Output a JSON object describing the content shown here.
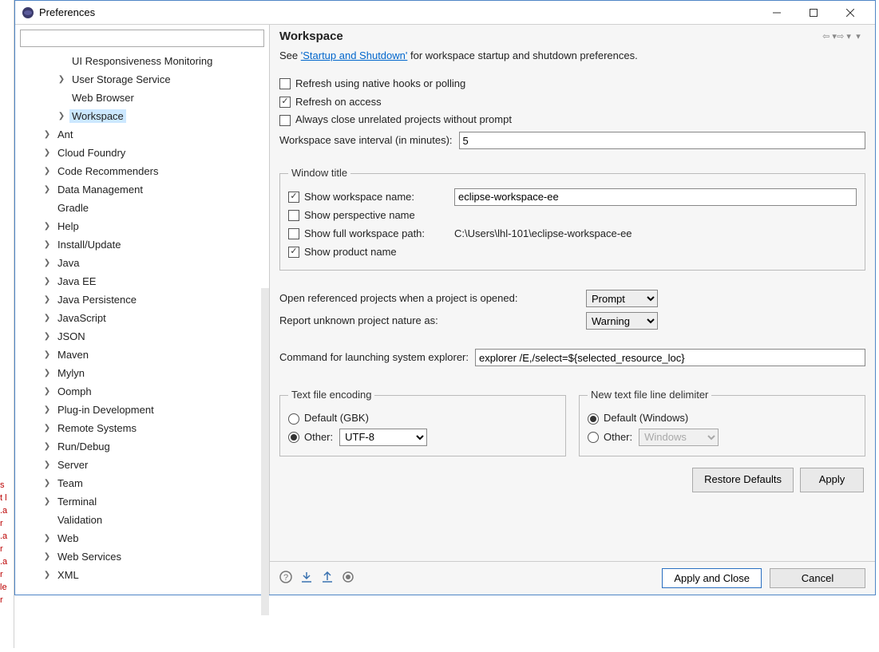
{
  "window": {
    "title": "Preferences"
  },
  "header": {
    "title": "Workspace",
    "see_prefix": "See ",
    "see_link": "'Startup and Shutdown'",
    "see_suffix": " for workspace startup and shutdown preferences."
  },
  "tree": [
    {
      "label": "UI Responsiveness Monitoring",
      "indent": 2,
      "expandable": false
    },
    {
      "label": "User Storage Service",
      "indent": 2,
      "expandable": true
    },
    {
      "label": "Web Browser",
      "indent": 2,
      "expandable": false
    },
    {
      "label": "Workspace",
      "indent": 2,
      "expandable": true,
      "selected": true
    },
    {
      "label": "Ant",
      "indent": 1,
      "expandable": true
    },
    {
      "label": "Cloud Foundry",
      "indent": 1,
      "expandable": true
    },
    {
      "label": "Code Recommenders",
      "indent": 1,
      "expandable": true
    },
    {
      "label": "Data Management",
      "indent": 1,
      "expandable": true
    },
    {
      "label": "Gradle",
      "indent": 1,
      "expandable": false
    },
    {
      "label": "Help",
      "indent": 1,
      "expandable": true
    },
    {
      "label": "Install/Update",
      "indent": 1,
      "expandable": true
    },
    {
      "label": "Java",
      "indent": 1,
      "expandable": true
    },
    {
      "label": "Java EE",
      "indent": 1,
      "expandable": true
    },
    {
      "label": "Java Persistence",
      "indent": 1,
      "expandable": true
    },
    {
      "label": "JavaScript",
      "indent": 1,
      "expandable": true
    },
    {
      "label": "JSON",
      "indent": 1,
      "expandable": true
    },
    {
      "label": "Maven",
      "indent": 1,
      "expandable": true
    },
    {
      "label": "Mylyn",
      "indent": 1,
      "expandable": true
    },
    {
      "label": "Oomph",
      "indent": 1,
      "expandable": true
    },
    {
      "label": "Plug-in Development",
      "indent": 1,
      "expandable": true
    },
    {
      "label": "Remote Systems",
      "indent": 1,
      "expandable": true
    },
    {
      "label": "Run/Debug",
      "indent": 1,
      "expandable": true
    },
    {
      "label": "Server",
      "indent": 1,
      "expandable": true
    },
    {
      "label": "Team",
      "indent": 1,
      "expandable": true
    },
    {
      "label": "Terminal",
      "indent": 1,
      "expandable": true
    },
    {
      "label": "Validation",
      "indent": 1,
      "expandable": false
    },
    {
      "label": "Web",
      "indent": 1,
      "expandable": true
    },
    {
      "label": "Web Services",
      "indent": 1,
      "expandable": true
    },
    {
      "label": "XML",
      "indent": 1,
      "expandable": true
    }
  ],
  "refresh_native": "Refresh using native hooks or polling",
  "refresh_access": "Refresh on access",
  "close_unrelated": "Always close unrelated projects without prompt",
  "save_interval_label": "Workspace save interval (in minutes):",
  "save_interval_value": "5",
  "fieldset_window_title": "Window title",
  "show_workspace_name_label": "Show workspace name:",
  "workspace_name_value": "eclipse-workspace-ee",
  "show_perspective": "Show perspective name",
  "show_full_path_label": "Show full workspace path:",
  "full_path": "C:\\Users\\lhl-101\\eclipse-workspace-ee",
  "show_product": "Show product name",
  "open_referenced_label": "Open referenced projects when a project is opened:",
  "open_referenced_value": "Prompt",
  "report_nature_label": "Report unknown project nature as:",
  "report_nature_value": "Warning",
  "explorer_label": "Command for launching system explorer:",
  "explorer_value": "explorer /E,/select=${selected_resource_loc}",
  "encoding_legend": "Text file encoding",
  "encoding_default": "Default (GBK)",
  "encoding_other": "Other:",
  "encoding_value": "UTF-8",
  "delimiter_legend": "New text file line delimiter",
  "delimiter_default": "Default (Windows)",
  "delimiter_other": "Other:",
  "delimiter_value": "Windows",
  "restore_defaults": "Restore Defaults",
  "apply": "Apply",
  "apply_close": "Apply and Close",
  "cancel": "Cancel"
}
